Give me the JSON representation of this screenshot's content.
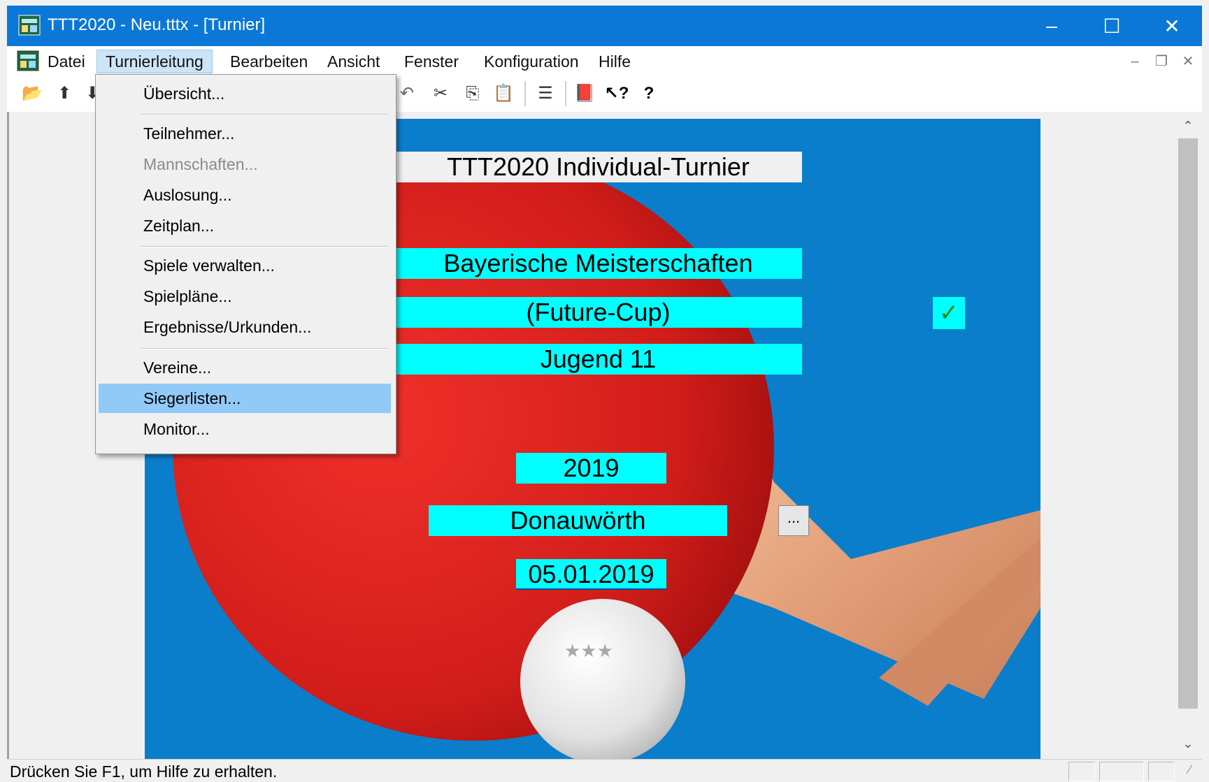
{
  "window": {
    "title": "TTT2020 - Neu.tttx - [Turnier]",
    "controls": {
      "minimize": "–",
      "maximize": "☐",
      "close": "✕"
    }
  },
  "menubar": {
    "items": [
      "Datei",
      "Turnierleitung",
      "Bearbeiten",
      "Ansicht",
      "Fenster",
      "Konfiguration",
      "Hilfe"
    ],
    "active": "Turnierleitung"
  },
  "turnierleitung_menu": {
    "items": [
      {
        "label": "Übersicht...",
        "enabled": true
      },
      {
        "label": "Teilnehmer...",
        "enabled": true
      },
      {
        "label": "Mannschaften...",
        "enabled": false
      },
      {
        "label": "Auslosung...",
        "enabled": true
      },
      {
        "label": "Zeitplan...",
        "enabled": true
      },
      {
        "label": "Spiele verwalten...",
        "enabled": true
      },
      {
        "label": "Spielpläne...",
        "enabled": true
      },
      {
        "label": "Ergebnisse/Urkunden...",
        "enabled": true
      },
      {
        "label": "Vereine...",
        "enabled": true
      },
      {
        "label": "Siegerlisten...",
        "enabled": true,
        "highlighted": true
      },
      {
        "label": "Monitor...",
        "enabled": true
      }
    ]
  },
  "tournament": {
    "type_title": "TTT2020 Individual-Turnier",
    "name": "Bayerische Meisterschaften",
    "subtitle": "(Future-Cup)",
    "subtitle_checked": true,
    "age_class": "Jugend 11",
    "year": "2019",
    "location": "Donauwörth",
    "location_button": "...",
    "date": "05.01.2019",
    "check_mark": "✓"
  },
  "statusbar": {
    "text": "Drücken Sie F1, um Hilfe zu erhalten."
  },
  "colors": {
    "titlebar": "#0b78d7",
    "canvas": "#0b7ecb",
    "field": "#00ffff",
    "paddle": "#d7201d",
    "menu_highlight": "#91c9f7"
  },
  "toolbar_icons": [
    "open-icon",
    "export-icon",
    "import-icon",
    "undo-icon",
    "cut-icon",
    "copy-icon",
    "paste-icon",
    "list-icon",
    "book-icon",
    "context-help-icon",
    "help-icon"
  ]
}
